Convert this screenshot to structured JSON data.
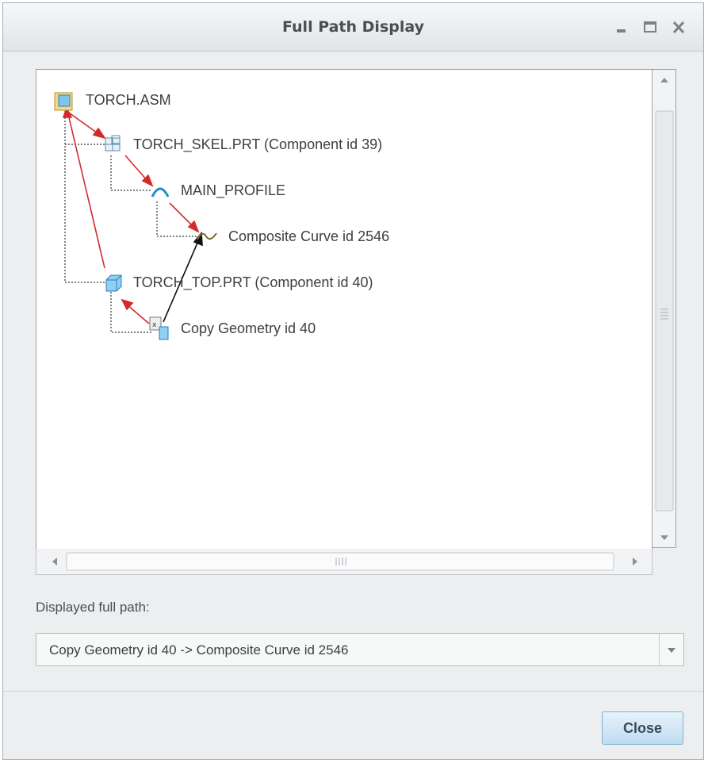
{
  "window": {
    "title": "Full Path Display"
  },
  "tree": {
    "nodes": [
      {
        "label": "TORCH.ASM",
        "icon": "assembly-icon"
      },
      {
        "label": "TORCH_SKEL.PRT (Component id 39)",
        "icon": "skeleton-part-icon"
      },
      {
        "label": "MAIN_PROFILE",
        "icon": "sketch-icon"
      },
      {
        "label": "Composite Curve id 2546",
        "icon": "composite-curve-icon"
      },
      {
        "label": "TORCH_TOP.PRT (Component id 40)",
        "icon": "part-icon"
      },
      {
        "label": "Copy Geometry id 40",
        "icon": "copy-geometry-icon"
      }
    ],
    "path_colors": {
      "parent_path": "#d22b2b",
      "reference_path": "#111111"
    }
  },
  "path_section": {
    "label": "Displayed full path:",
    "value": "Copy Geometry id 40 -> Composite Curve id 2546"
  },
  "buttons": {
    "close_label": "Close"
  }
}
